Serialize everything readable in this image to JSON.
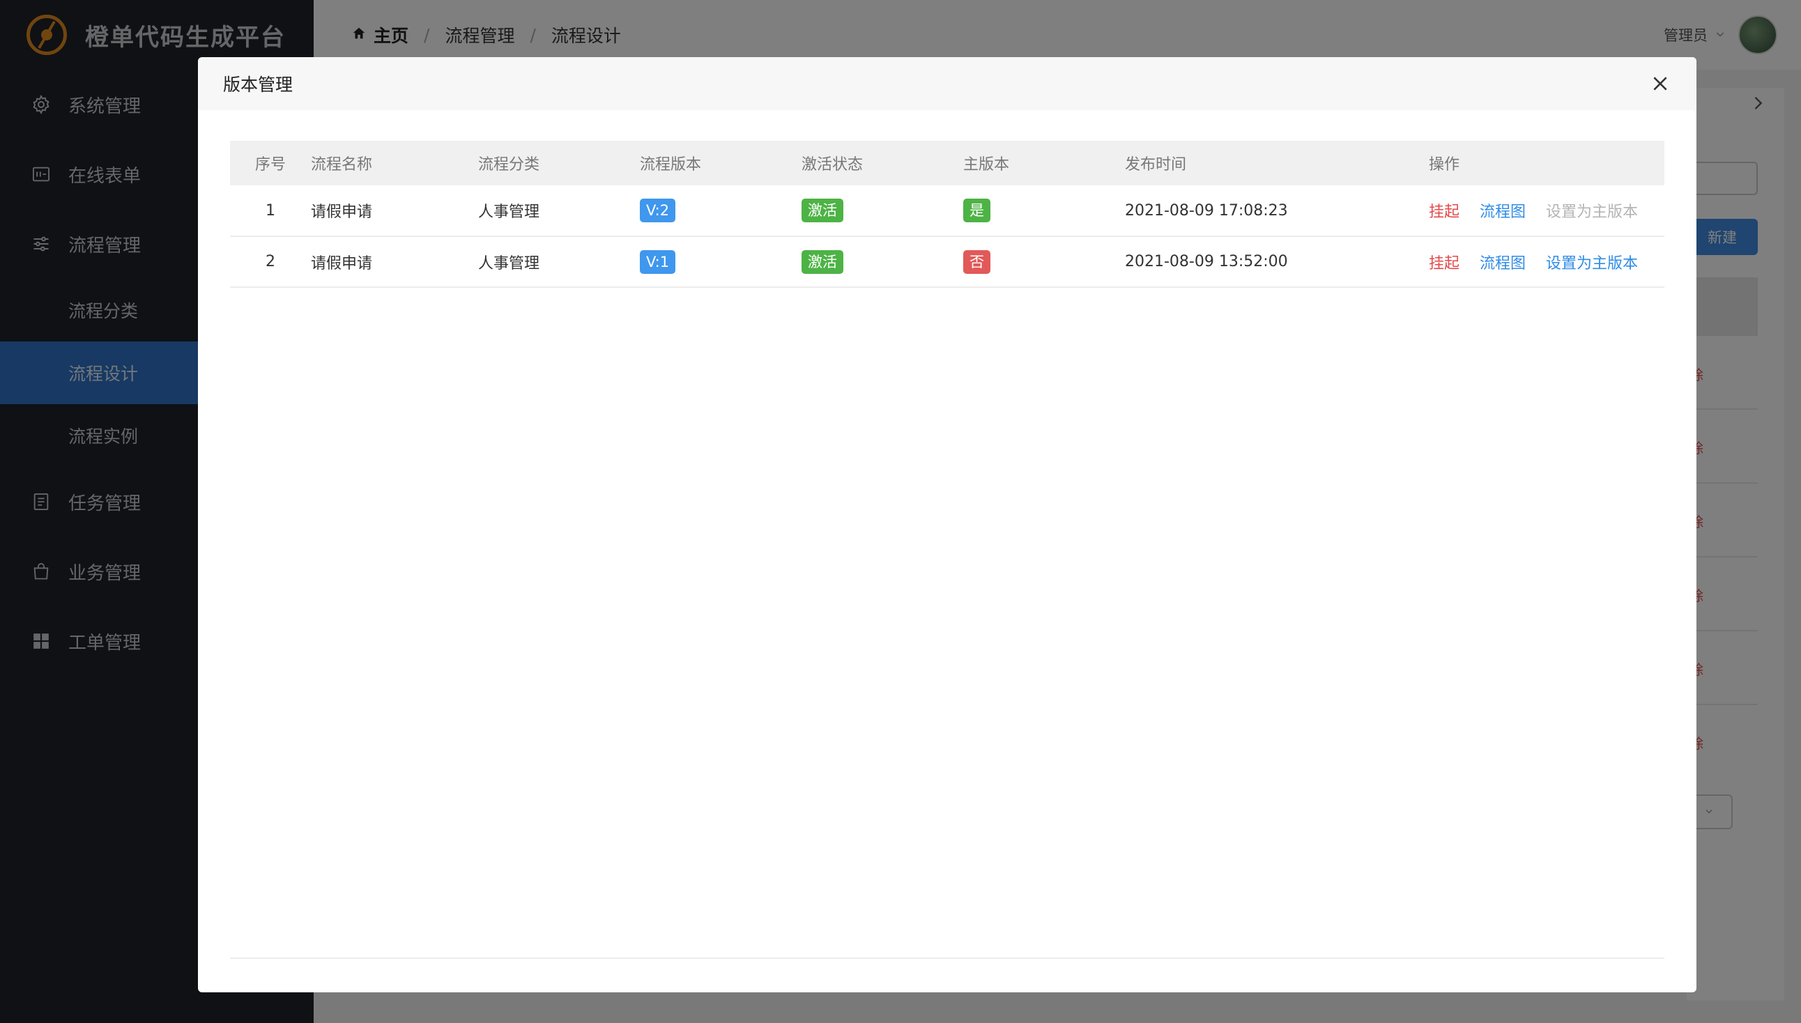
{
  "brand": {
    "title": "橙单代码生成平台"
  },
  "sidebar": {
    "items": [
      {
        "label": "系统管理",
        "icon": "gear-icon"
      },
      {
        "label": "在线表单",
        "icon": "form-icon"
      },
      {
        "label": "流程管理",
        "icon": "sliders-icon"
      },
      {
        "label": "流程分类"
      },
      {
        "label": "流程设计"
      },
      {
        "label": "流程实例"
      },
      {
        "label": "任务管理",
        "icon": "document-icon"
      },
      {
        "label": "业务管理",
        "icon": "bag-icon"
      },
      {
        "label": "工单管理",
        "icon": "grid-icon"
      }
    ]
  },
  "header": {
    "breadcrumb": [
      "主页",
      "流程管理",
      "流程设计"
    ],
    "user": "管理员"
  },
  "background": {
    "new_button": "新建",
    "delete_fragment": "除"
  },
  "modal": {
    "title": "版本管理",
    "columns": [
      "序号",
      "流程名称",
      "流程分类",
      "流程版本",
      "激活状态",
      "主版本",
      "发布时间",
      "操作"
    ],
    "rows": [
      {
        "index": "1",
        "name": "请假申请",
        "category": "人事管理",
        "version": "V:2",
        "status": "激活",
        "main": "是",
        "time": "2021-08-09 17:08:23",
        "op1": "挂起",
        "op2": "流程图",
        "op3": "设置为主版本"
      },
      {
        "index": "2",
        "name": "请假申请",
        "category": "人事管理",
        "version": "V:1",
        "status": "激活",
        "main": "否",
        "time": "2021-08-09 13:52:00",
        "op1": "挂起",
        "op2": "流程图",
        "op3": "设置为主版本"
      }
    ]
  },
  "colors": {
    "sidebar_bg": "#1f2329",
    "active_menu": "#2f72c6",
    "tag_blue": "#3f97ee",
    "tag_green": "#4db345",
    "tag_red": "#e25959",
    "link_red": "#e24a4a",
    "link_blue": "#2f8ce6"
  }
}
